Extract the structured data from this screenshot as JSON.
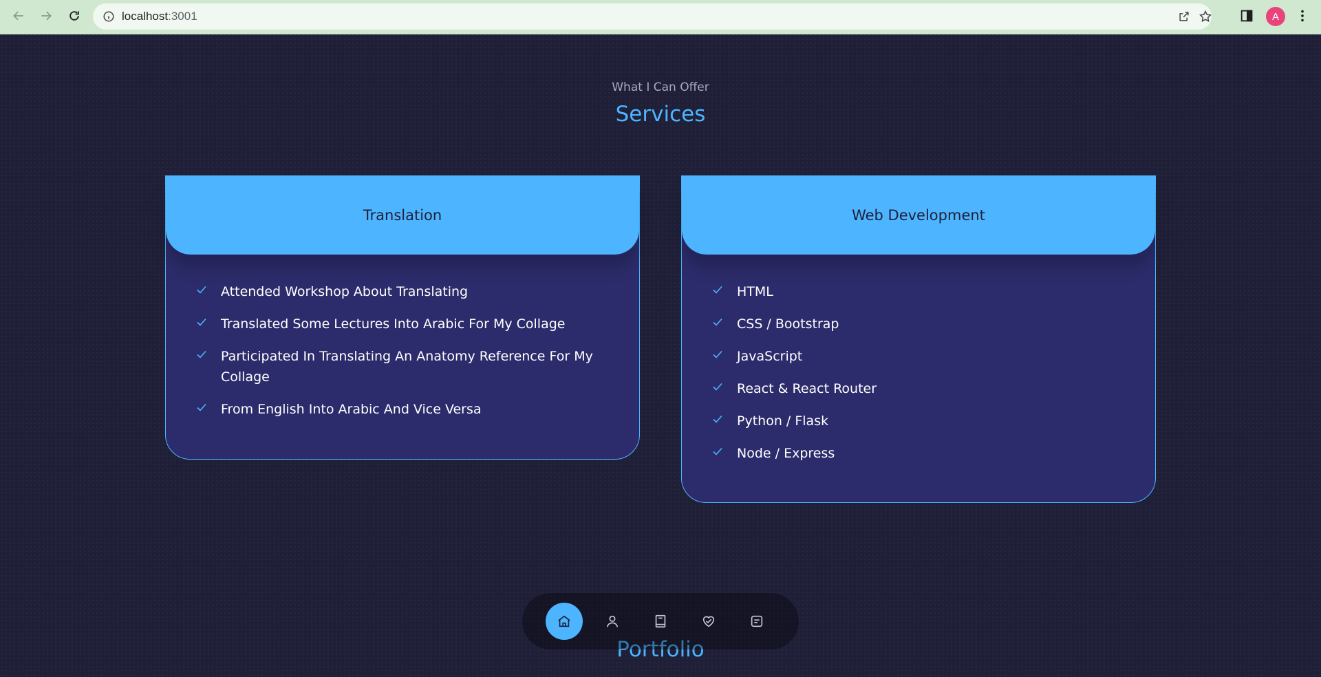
{
  "browser": {
    "url_host": "localhost",
    "url_port": ":3001",
    "profile_initial": "A",
    "icons": [
      "back-icon",
      "forward-icon",
      "reload-icon",
      "info-icon",
      "share-icon",
      "star-icon",
      "side-panel-icon",
      "menu-icon"
    ]
  },
  "section": {
    "subtitle": "What I Can Offer",
    "title": "Services"
  },
  "cards": [
    {
      "heading": "Translation",
      "items": [
        "Attended Workshop About Translating",
        "Translated Some Lectures Into Arabic For My Collage",
        "Participated In Translating An Anatomy Reference For My Collage",
        "From English Into Arabic And Vice Versa"
      ]
    },
    {
      "heading": "Web Development",
      "items": [
        "HTML",
        "CSS / Bootstrap",
        "JavaScript",
        "React & React Router",
        "Python / Flask",
        "Node / Express"
      ]
    }
  ],
  "next_section_title": "Portfolio",
  "nav": {
    "items": [
      "home-icon",
      "user-icon",
      "book-icon",
      "services-icon",
      "message-icon"
    ],
    "active": "home-icon"
  },
  "colors": {
    "accent": "#4db5ff",
    "background": "#1f1f38",
    "card_bg": "#2c2c6c"
  }
}
